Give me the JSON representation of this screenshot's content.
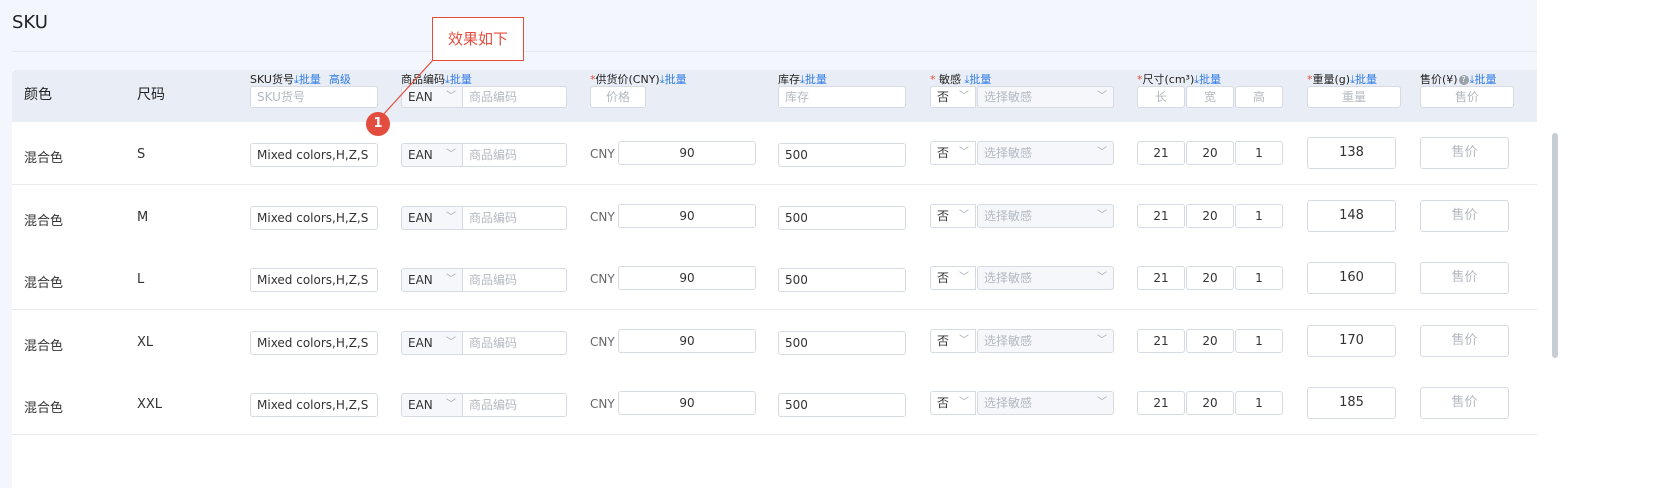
{
  "section_title": "SKU",
  "callout": {
    "label": "效果如下",
    "marker": "1"
  },
  "header": {
    "color": "颜色",
    "size": "尺码",
    "sku_no": "SKU货号",
    "batch": "批量",
    "advanced": "高级",
    "product_code": "商品编码",
    "supply_price": "供货价(CNY)",
    "stock": "库存",
    "sensitive": "敏感",
    "dimensions": "尺寸(cm³)",
    "weight": "重量(g)",
    "sale_price": "售价(¥)",
    "required_mark": "*",
    "batch_icon": "download-icon"
  },
  "filters": {
    "sku_placeholder": "SKU货号",
    "code_type": "EAN",
    "code_placeholder": "商品编码",
    "price_placeholder": "价格",
    "stock_placeholder": "库存",
    "sensitive_value": "否",
    "sensitive_placeholder": "选择敏感",
    "length_placeholder": "长",
    "width_placeholder": "宽",
    "height_placeholder": "高",
    "weight_placeholder": "重量",
    "sale_placeholder": "售价"
  },
  "rows": [
    {
      "color": "混合色",
      "size": "S",
      "sku": "Mixed colors,H,Z,S",
      "code_type": "EAN",
      "code_placeholder": "商品编码",
      "currency": "CNY",
      "price": "90",
      "stock": "500",
      "sensitive": "否",
      "sensitive_placeholder": "选择敏感",
      "length": "21",
      "width": "20",
      "height": "1",
      "weight": "138",
      "sale_placeholder": "售价"
    },
    {
      "color": "混合色",
      "size": "M",
      "sku": "Mixed colors,H,Z,S",
      "code_type": "EAN",
      "code_placeholder": "商品编码",
      "currency": "CNY",
      "price": "90",
      "stock": "500",
      "sensitive": "否",
      "sensitive_placeholder": "选择敏感",
      "length": "21",
      "width": "20",
      "height": "1",
      "weight": "148",
      "sale_placeholder": "售价"
    },
    {
      "color": "混合色",
      "size": "L",
      "sku": "Mixed colors,H,Z,S",
      "code_type": "EAN",
      "code_placeholder": "商品编码",
      "currency": "CNY",
      "price": "90",
      "stock": "500",
      "sensitive": "否",
      "sensitive_placeholder": "选择敏感",
      "length": "21",
      "width": "20",
      "height": "1",
      "weight": "160",
      "sale_placeholder": "售价"
    },
    {
      "color": "混合色",
      "size": "XL",
      "sku": "Mixed colors,H,Z,S",
      "code_type": "EAN",
      "code_placeholder": "商品编码",
      "currency": "CNY",
      "price": "90",
      "stock": "500",
      "sensitive": "否",
      "sensitive_placeholder": "选择敏感",
      "length": "21",
      "width": "20",
      "height": "1",
      "weight": "170",
      "sale_placeholder": "售价"
    },
    {
      "color": "混合色",
      "size": "XXL",
      "sku": "Mixed colors,H,Z,S",
      "code_type": "EAN",
      "code_placeholder": "商品编码",
      "currency": "CNY",
      "price": "90",
      "stock": "500",
      "sensitive": "否",
      "sensitive_placeholder": "选择敏感",
      "length": "21",
      "width": "20",
      "height": "1",
      "weight": "185",
      "sale_placeholder": "售价"
    }
  ],
  "colors": {
    "accent": "#2f7ae5",
    "required": "#e34d3f",
    "callout": "#e34d3f",
    "header_bg": "#e9eef6"
  }
}
